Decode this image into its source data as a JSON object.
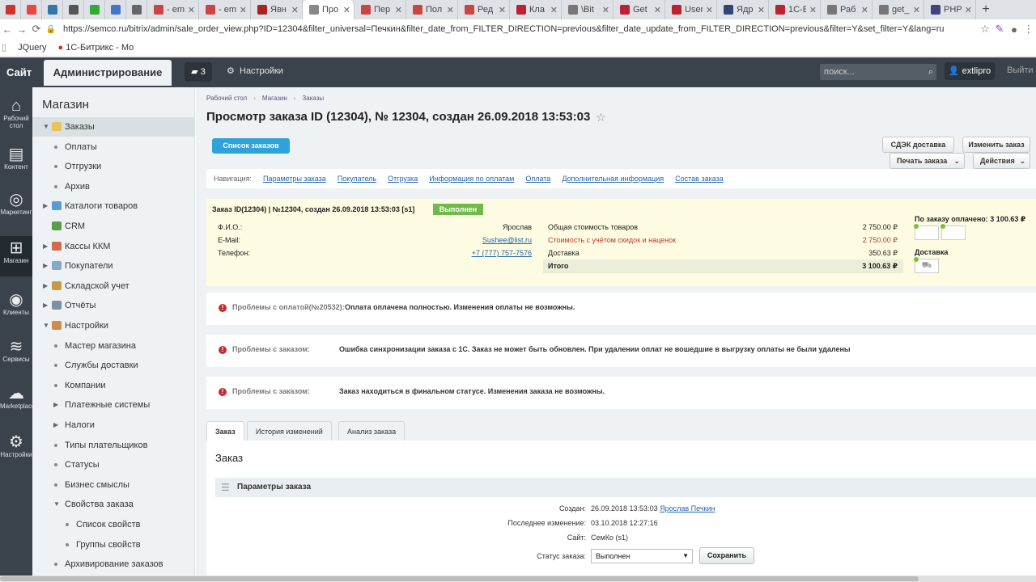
{
  "browser": {
    "tabs": [
      {
        "title": "",
        "fav": "#c33",
        "pinned": true
      },
      {
        "title": "",
        "fav": "#e44",
        "pinned": true
      },
      {
        "title": "",
        "fav": "#37a",
        "pinned": true
      },
      {
        "title": "",
        "fav": "#555",
        "pinned": true
      },
      {
        "title": "",
        "fav": "#3a3",
        "pinned": true
      },
      {
        "title": "",
        "fav": "#47c",
        "pinned": true
      },
      {
        "title": "",
        "fav": "#666",
        "pinned": true
      },
      {
        "title": "- em",
        "fav": "#c44",
        "pinned": false
      },
      {
        "title": "- em",
        "fav": "#c44",
        "pinned": false
      },
      {
        "title": "Явн",
        "fav": "#a22",
        "pinned": false
      },
      {
        "title": "Про",
        "fav": "#888",
        "pinned": false,
        "active": true
      },
      {
        "title": "Пер",
        "fav": "#c44",
        "pinned": false
      },
      {
        "title": "Пол",
        "fav": "#c44",
        "pinned": false
      },
      {
        "title": "Ред",
        "fav": "#c44",
        "pinned": false
      },
      {
        "title": "Кла",
        "fav": "#b23",
        "pinned": false
      },
      {
        "title": "\\Bit",
        "fav": "#777",
        "pinned": false
      },
      {
        "title": "Get",
        "fav": "#b23",
        "pinned": false
      },
      {
        "title": "User",
        "fav": "#b23",
        "pinned": false
      },
      {
        "title": "Ядр",
        "fav": "#347",
        "pinned": false
      },
      {
        "title": "1С-Е",
        "fav": "#b23",
        "pinned": false
      },
      {
        "title": "Раб",
        "fav": "#777",
        "pinned": false
      },
      {
        "title": "get_",
        "fav": "#777",
        "pinned": false
      },
      {
        "title": "PHP",
        "fav": "#447",
        "pinned": false
      }
    ],
    "new_tab": "+",
    "url": "https://semco.ru/bitrix/admin/sale_order_view.php?ID=12304&filter_universal=Печкин&filter_date_from_FILTER_DIRECTION=previous&filter_date_update_from_FILTER_DIRECTION=previous&filter=Y&set_filter=Y&lang=ru",
    "bookmarks": [
      "JQuery",
      "1С-Битрикс - Мо"
    ]
  },
  "topbar": {
    "site": "Сайт",
    "admin": "Администрирование",
    "notif_count": "3",
    "settings": "Настройки",
    "search_placeholder": "поиск...",
    "user": "extlipro",
    "logout": "Выйти"
  },
  "iconbar": [
    {
      "label": "Рабочий стол",
      "icon": "home-icon",
      "glyph": "⌂"
    },
    {
      "label": "Контент",
      "icon": "content-icon",
      "glyph": "▤"
    },
    {
      "label": "Маркетинг",
      "icon": "marketing-icon",
      "glyph": "◎"
    },
    {
      "label": "Магазин",
      "icon": "shop-icon",
      "glyph": "⊞",
      "active": true
    },
    {
      "label": "Клиенты",
      "icon": "clients-icon",
      "glyph": "◉"
    },
    {
      "label": "Сервисы",
      "icon": "services-icon",
      "glyph": "≋"
    },
    {
      "label": "Marketplace",
      "icon": "marketplace-icon",
      "glyph": "☁"
    },
    {
      "label": "Настройки",
      "icon": "settings-icon",
      "glyph": "⚙"
    }
  ],
  "menu": {
    "title": "Магазин",
    "items": [
      {
        "label": "Заказы",
        "level": 0,
        "arrow": "▼",
        "icon": "#e8c25a",
        "sel": true
      },
      {
        "label": "Оплаты",
        "level": 1
      },
      {
        "label": "Отгрузки",
        "level": 1
      },
      {
        "label": "Архив",
        "level": 1
      },
      {
        "label": "Каталоги товаров",
        "level": 0,
        "arrow": "▶",
        "icon": "#5b9bd5"
      },
      {
        "label": "CRM",
        "level": 0,
        "arrow": "",
        "icon": "#5a9e4c"
      },
      {
        "label": "Кассы ККМ",
        "level": 0,
        "arrow": "▶",
        "icon": "#d26b4a"
      },
      {
        "label": "Покупатели",
        "level": 0,
        "arrow": "▶",
        "icon": "#8aa7c7"
      },
      {
        "label": "Складской учет",
        "level": 0,
        "arrow": "▶",
        "icon": "#c79a4a"
      },
      {
        "label": "Отчёты",
        "level": 0,
        "arrow": "▶",
        "icon": "#7d8fa1"
      },
      {
        "label": "Настройки",
        "level": 0,
        "arrow": "▼",
        "icon": "#d08a4a"
      },
      {
        "label": "Мастер магазина",
        "level": 1
      },
      {
        "label": "Службы доставки",
        "level": 1
      },
      {
        "label": "Компании",
        "level": 1
      },
      {
        "label": "Платежные системы",
        "level": 1,
        "arrow": "▶"
      },
      {
        "label": "Налоги",
        "level": 1,
        "arrow": "▶"
      },
      {
        "label": "Типы плательщиков",
        "level": 1
      },
      {
        "label": "Статусы",
        "level": 1
      },
      {
        "label": "Бизнес смыслы",
        "level": 1
      },
      {
        "label": "Свойства заказа",
        "level": 1,
        "arrow": "▼"
      },
      {
        "label": "Список свойств",
        "level": 2
      },
      {
        "label": "Группы свойств",
        "level": 2
      },
      {
        "label": "Архивирование заказов",
        "level": 1
      }
    ]
  },
  "breadcrumb": [
    "Рабочий стол",
    "Магазин",
    "Заказы"
  ],
  "page_title": "Просмотр заказа ID (12304), № 12304, создан 26.09.2018 13:53:03",
  "buttons": {
    "list": "Список заказов",
    "cdek": "СДЭК доставка",
    "edit": "Изменить заказ",
    "print": "Печать заказа",
    "actions": "Действия"
  },
  "nav": {
    "label": "Навигация:",
    "links": [
      "Параметры заказа",
      "Покупатель",
      "Отгрузка",
      "Информация по оплатам",
      "Оплата",
      "Дополнительная информация",
      "Состав заказа"
    ]
  },
  "summary": {
    "head": "Заказ ID(12304) | №12304, создан 26.09.2018 13:53:03 [s1]",
    "status": "Выполнен",
    "fio_label": "Ф.И.О.:",
    "fio": "Ярослав",
    "email_label": "E-Mail:",
    "email": "Sushee@list.ru",
    "phone_label": "Телефон:",
    "phone": "+7 (777) 757-7576",
    "total_goods_label": "Общая стоимость товаров",
    "total_goods": "2 750.00 ₽",
    "discount_label": "Стоимость с учётом скидок и наценок",
    "discount": "2 750.00 ₽",
    "delivery_label": "Доставка",
    "delivery": "350.63 ₽",
    "itogo_label": "Итого",
    "itogo": "3 100.63 ₽",
    "paid": "По заказу оплачено: 3 100.63 ₽",
    "delivery_head": "Доставка"
  },
  "problems": [
    {
      "label": "Проблемы с оплатой(№20532):",
      "message": "Оплата оплачена полностью. Изменения оплаты не возможны."
    },
    {
      "label": "Проблемы с заказом:",
      "message": "Ошибка синхронизации заказа с 1С. Заказ не может быть обновлен. При удалении оплат не вошедшие в выгрузку оплаты не были удалены"
    },
    {
      "label": "Проблемы с заказом:",
      "message": "Заказ находиться в финальном статусе. Изменения заказа не возможны."
    }
  ],
  "tabs": [
    "Заказ",
    "История изменений",
    "Анализ заказа"
  ],
  "order": {
    "title": "Заказ",
    "params_title": "Параметры заказа",
    "created_label": "Создан:",
    "created": "26.09.2018 13:53:03",
    "creator": "Ярослав Печкин",
    "modified_label": "Последнее изменение:",
    "modified": "03.10.2018 12:27:16",
    "site_label": "Сайт:",
    "site": "СемКо (s1)",
    "status_label": "Статус заказа:",
    "status": "Выполнен",
    "save": "Сохранить"
  }
}
